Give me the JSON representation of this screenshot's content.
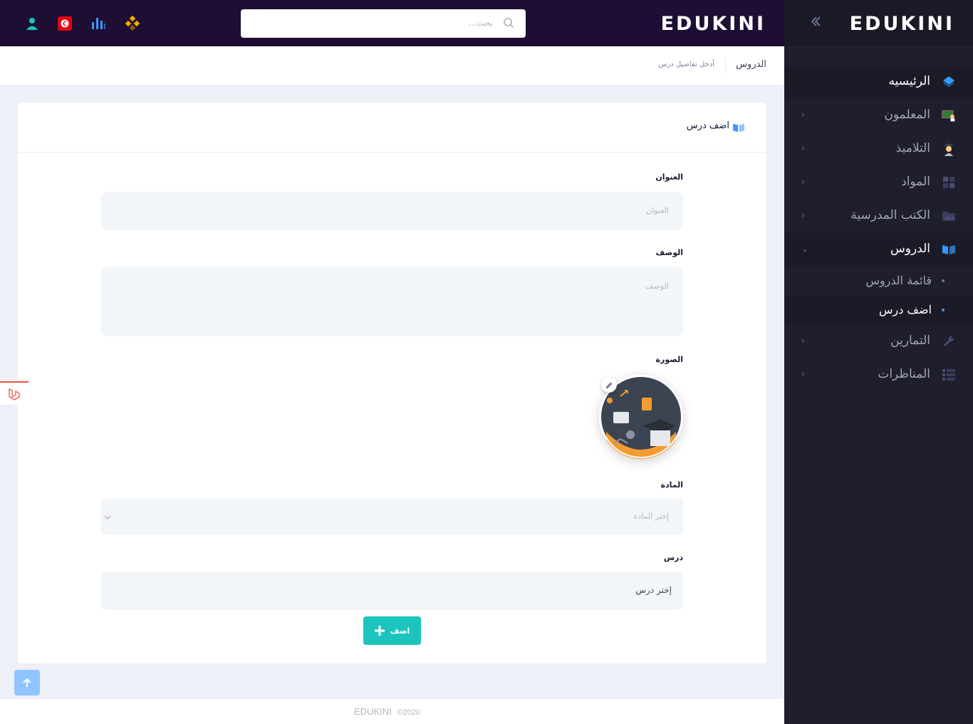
{
  "brand": {
    "logo": "EDUKINI"
  },
  "header": {
    "logo": "EDUKINI",
    "search_placeholder": "بحث..."
  },
  "sidebar": {
    "items": [
      {
        "label": "الرئيسيه",
        "icon": "layers-icon"
      },
      {
        "label": "المعلمون",
        "icon": "teacher-icon"
      },
      {
        "label": "التلاميذ",
        "icon": "student-icon"
      },
      {
        "label": "المواد",
        "icon": "grid-icon"
      },
      {
        "label": "الكتب المدرسية",
        "icon": "folder-icon"
      },
      {
        "label": "الدروس",
        "icon": "book-icon"
      },
      {
        "label": "التمارين",
        "icon": "wrench-icon"
      },
      {
        "label": "المناظرات",
        "icon": "list-icon"
      }
    ],
    "submenu": [
      {
        "label": "قائمة الدروس"
      },
      {
        "label": "اضف درس"
      }
    ]
  },
  "subheader": {
    "title": "الدروس",
    "description": "أدخل تفاصيل درس"
  },
  "form": {
    "card_title": "اضف درس",
    "title_label": "العنوان",
    "title_placeholder": "العنوان",
    "description_label": "الوصف",
    "description_placeholder": "الوصف",
    "image_label": "الصورة",
    "subject_label": "المادة",
    "subject_placeholder": "إختر المادة",
    "lesson_label": "درس",
    "lesson_value": "إختر درس",
    "submit_label": "اضف"
  },
  "footer": {
    "brand": "EDUKINI",
    "year": "©2020"
  },
  "colors": {
    "header_bg": "#1e0e33",
    "sidebar_bg": "#1e1e2d",
    "accent": "#3699ff",
    "submit": "#1bc5bd"
  }
}
